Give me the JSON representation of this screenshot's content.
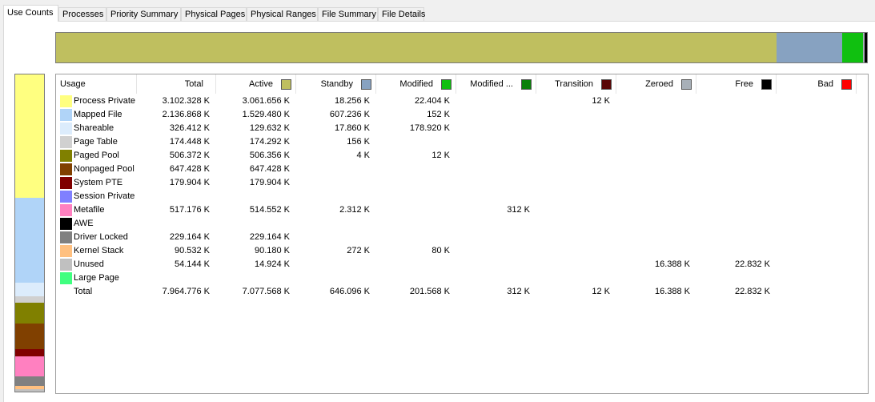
{
  "tabs": [
    {
      "label": "Use Counts",
      "active": true
    },
    {
      "label": "Processes"
    },
    {
      "label": "Priority Summary"
    },
    {
      "label": "Physical Pages"
    },
    {
      "label": "Physical Ranges"
    },
    {
      "label": "File Summary"
    },
    {
      "label": "File Details"
    }
  ],
  "columns": [
    {
      "key": "usage",
      "label": "Usage",
      "color": null
    },
    {
      "key": "total",
      "label": "Total",
      "color": null
    },
    {
      "key": "active",
      "label": "Active",
      "color": "#bfbf5f"
    },
    {
      "key": "standby",
      "label": "Standby",
      "color": "#87a2c1"
    },
    {
      "key": "modified",
      "label": "Modified",
      "color": "#10c010"
    },
    {
      "key": "modified_no_write",
      "label": "Modified ...",
      "color": "#0a800a"
    },
    {
      "key": "transition",
      "label": "Transition",
      "color": "#5a0606"
    },
    {
      "key": "zeroed",
      "label": "Zeroed",
      "color": "#a8b0b8"
    },
    {
      "key": "free",
      "label": "Free",
      "color": "#000000"
    },
    {
      "key": "bad",
      "label": "Bad",
      "color": "#ff0000"
    }
  ],
  "rows": [
    {
      "name": "Process Private",
      "color": "#ffff80",
      "total": "3.102.328 K",
      "active": "3.061.656 K",
      "standby": "18.256 K",
      "modified": "22.404 K",
      "modified_no_write": "",
      "transition": "12 K",
      "zeroed": "",
      "free": "",
      "bad": ""
    },
    {
      "name": "Mapped File",
      "color": "#b0d4f8",
      "total": "2.136.868 K",
      "active": "1.529.480 K",
      "standby": "607.236 K",
      "modified": "152 K",
      "modified_no_write": "",
      "transition": "",
      "zeroed": "",
      "free": "",
      "bad": ""
    },
    {
      "name": "Shareable",
      "color": "#dcecfc",
      "total": "326.412 K",
      "active": "129.632 K",
      "standby": "17.860 K",
      "modified": "178.920 K",
      "modified_no_write": "",
      "transition": "",
      "zeroed": "",
      "free": "",
      "bad": ""
    },
    {
      "name": "Page Table",
      "color": "#d0d0d0",
      "total": "174.448 K",
      "active": "174.292 K",
      "standby": "156 K",
      "modified": "",
      "modified_no_write": "",
      "transition": "",
      "zeroed": "",
      "free": "",
      "bad": ""
    },
    {
      "name": "Paged Pool",
      "color": "#808000",
      "total": "506.372 K",
      "active": "506.356 K",
      "standby": "4 K",
      "modified": "12 K",
      "modified_no_write": "",
      "transition": "",
      "zeroed": "",
      "free": "",
      "bad": ""
    },
    {
      "name": "Nonpaged Pool",
      "color": "#804000",
      "total": "647.428 K",
      "active": "647.428 K",
      "standby": "",
      "modified": "",
      "modified_no_write": "",
      "transition": "",
      "zeroed": "",
      "free": "",
      "bad": ""
    },
    {
      "name": "System PTE",
      "color": "#800000",
      "total": "179.904 K",
      "active": "179.904 K",
      "standby": "",
      "modified": "",
      "modified_no_write": "",
      "transition": "",
      "zeroed": "",
      "free": "",
      "bad": ""
    },
    {
      "name": "Session Private",
      "color": "#8080ff",
      "total": "",
      "active": "",
      "standby": "",
      "modified": "",
      "modified_no_write": "",
      "transition": "",
      "zeroed": "",
      "free": "",
      "bad": ""
    },
    {
      "name": "Metafile",
      "color": "#ff80c0",
      "total": "517.176 K",
      "active": "514.552 K",
      "standby": "2.312 K",
      "modified": "",
      "modified_no_write": "312 K",
      "transition": "",
      "zeroed": "",
      "free": "",
      "bad": ""
    },
    {
      "name": "AWE",
      "color": "#000000",
      "total": "",
      "active": "",
      "standby": "",
      "modified": "",
      "modified_no_write": "",
      "transition": "",
      "zeroed": "",
      "free": "",
      "bad": ""
    },
    {
      "name": "Driver Locked",
      "color": "#808080",
      "total": "229.164 K",
      "active": "229.164 K",
      "standby": "",
      "modified": "",
      "modified_no_write": "",
      "transition": "",
      "zeroed": "",
      "free": "",
      "bad": ""
    },
    {
      "name": "Kernel Stack",
      "color": "#ffc080",
      "total": "90.532 K",
      "active": "90.180 K",
      "standby": "272 K",
      "modified": "80 K",
      "modified_no_write": "",
      "transition": "",
      "zeroed": "",
      "free": "",
      "bad": ""
    },
    {
      "name": "Unused",
      "color": "#c0c0c0",
      "total": "54.144 K",
      "active": "14.924 K",
      "standby": "",
      "modified": "",
      "modified_no_write": "",
      "transition": "",
      "zeroed": "16.388 K",
      "free": "22.832 K",
      "bad": ""
    },
    {
      "name": "Large Page",
      "color": "#40ff80",
      "total": "",
      "active": "",
      "standby": "",
      "modified": "",
      "modified_no_write": "",
      "transition": "",
      "zeroed": "",
      "free": "",
      "bad": ""
    },
    {
      "name": "Total",
      "color": null,
      "total": "7.964.776 K",
      "active": "7.077.568 K",
      "standby": "646.096 K",
      "modified": "201.568 K",
      "modified_no_write": "312 K",
      "transition": "12 K",
      "zeroed": "16.388 K",
      "free": "22.832 K",
      "bad": ""
    }
  ],
  "state_bar": [
    {
      "state": "Active",
      "kb": 7077568,
      "color": "#bfbf5f"
    },
    {
      "state": "Standby",
      "kb": 646096,
      "color": "#87a2c1"
    },
    {
      "state": "Modified",
      "kb": 201568,
      "color": "#10c010"
    },
    {
      "state": "Modified ...",
      "kb": 312,
      "color": "#0a800a"
    },
    {
      "state": "Transition",
      "kb": 12,
      "color": "#5a0606"
    },
    {
      "state": "Zeroed",
      "kb": 16388,
      "color": "#a8b0b8"
    },
    {
      "state": "Free",
      "kb": 22832,
      "color": "#000000"
    }
  ],
  "usage_bar": [
    {
      "usage": "Process Private",
      "kb": 3102328,
      "color": "#ffff80"
    },
    {
      "usage": "Mapped File",
      "kb": 2136868,
      "color": "#b0d4f8"
    },
    {
      "usage": "Shareable",
      "kb": 326412,
      "color": "#dcecfc"
    },
    {
      "usage": "Page Table",
      "kb": 174448,
      "color": "#d0d0d0"
    },
    {
      "usage": "Paged Pool",
      "kb": 506372,
      "color": "#808000"
    },
    {
      "usage": "Nonpaged Pool",
      "kb": 647428,
      "color": "#804000"
    },
    {
      "usage": "System PTE",
      "kb": 179904,
      "color": "#800000"
    },
    {
      "usage": "Metafile",
      "kb": 517176,
      "color": "#ff80c0"
    },
    {
      "usage": "Driver Locked",
      "kb": 229164,
      "color": "#808080"
    },
    {
      "usage": "Kernel Stack",
      "kb": 90532,
      "color": "#ffc080"
    },
    {
      "usage": "Unused",
      "kb": 54144,
      "color": "#c0c0c0"
    }
  ]
}
